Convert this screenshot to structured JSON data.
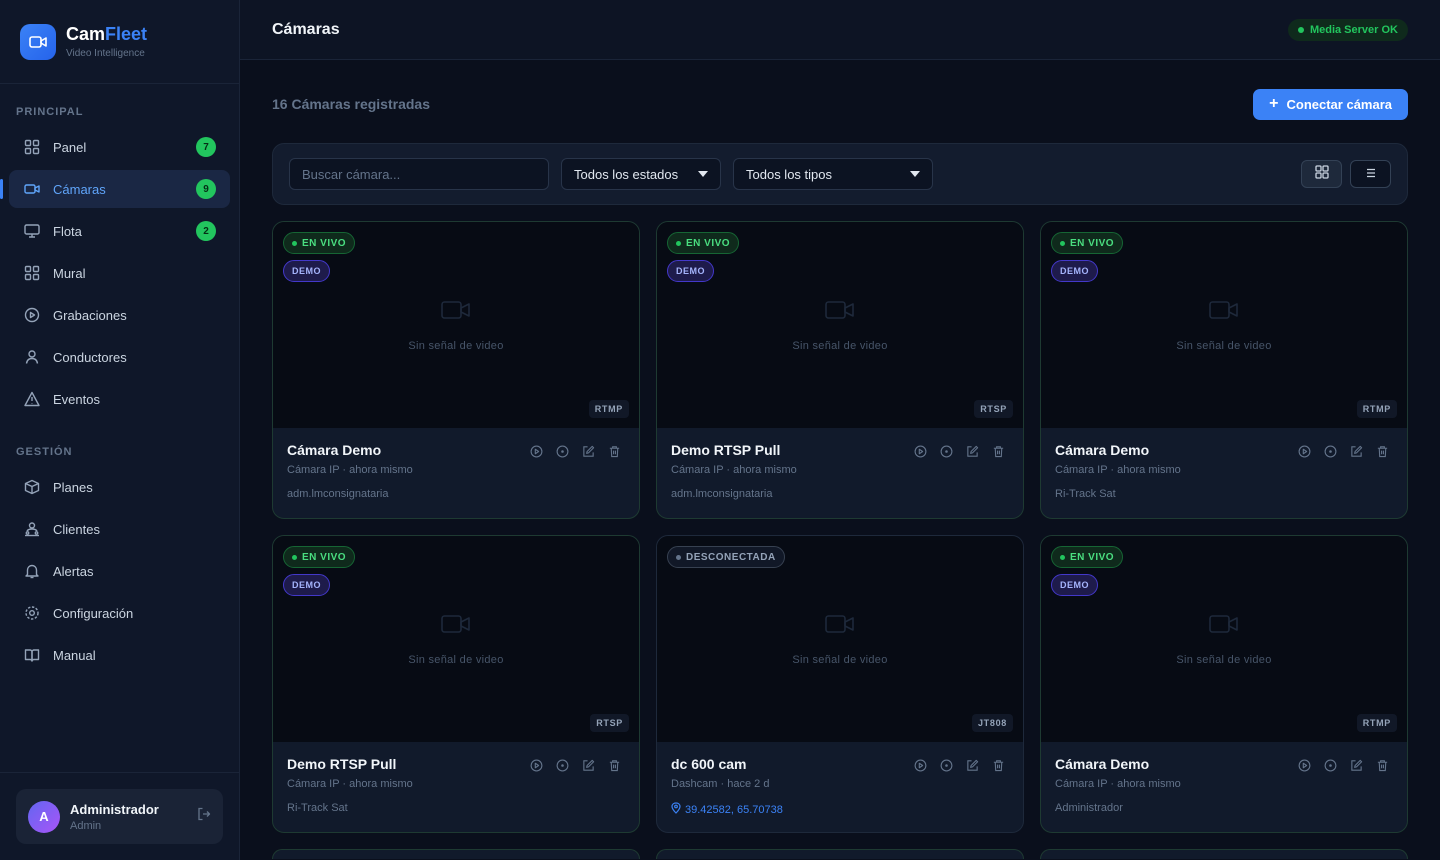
{
  "brand": {
    "name_a": "Cam",
    "name_b": "Fleet",
    "subtitle": "Video Intelligence"
  },
  "sidebar": {
    "sections": [
      {
        "title": "PRINCIPAL"
      },
      {
        "title": "GESTIÓN"
      }
    ],
    "items": [
      {
        "label": "Panel",
        "badge": "7"
      },
      {
        "label": "Cámaras",
        "badge": "9"
      },
      {
        "label": "Flota",
        "badge": "2"
      },
      {
        "label": "Mural"
      },
      {
        "label": "Grabaciones"
      },
      {
        "label": "Conductores"
      },
      {
        "label": "Eventos"
      },
      {
        "label": "Planes"
      },
      {
        "label": "Clientes"
      },
      {
        "label": "Alertas"
      },
      {
        "label": "Configuración"
      },
      {
        "label": "Manual"
      }
    ],
    "user": {
      "initial": "A",
      "name": "Administrador",
      "role": "Admin"
    }
  },
  "topbar": {
    "title": "Cámaras",
    "status": "Media Server OK"
  },
  "main": {
    "count_label": "16 Cámaras registradas",
    "connect_label": "Conectar cámara",
    "search_placeholder": "Buscar cámara...",
    "filter_status": "Todos los estados",
    "filter_type": "Todos los tipos"
  },
  "labels": {
    "live": "EN VIVO",
    "offline": "DESCONECTADA",
    "demo": "DEMO",
    "no_signal": "Sin señal de video"
  },
  "cameras": [
    {
      "name": "Cámara Demo",
      "meta": "Cámara IP · ahora mismo",
      "owner": "adm.lmconsignataria",
      "protocol": "RTMP",
      "status": "live",
      "demo": true
    },
    {
      "name": "Demo RTSP Pull",
      "meta": "Cámara IP · ahora mismo",
      "owner": "adm.lmconsignataria",
      "protocol": "RTSP",
      "status": "live",
      "demo": true
    },
    {
      "name": "Cámara Demo",
      "meta": "Cámara IP · ahora mismo",
      "owner": "Ri-Track Sat",
      "protocol": "RTMP",
      "status": "live",
      "demo": true
    },
    {
      "name": "Demo RTSP Pull",
      "meta": "Cámara IP · ahora mismo",
      "owner": "Ri-Track Sat",
      "protocol": "RTSP",
      "status": "live",
      "demo": true
    },
    {
      "name": "dc 600 cam",
      "meta": "Dashcam · hace 2 d",
      "coords": "39.42582, 65.70738",
      "protocol": "JT808",
      "status": "offline",
      "demo": false
    },
    {
      "name": "Cámara Demo",
      "meta": "Cámara IP · ahora mismo",
      "owner": "Administrador",
      "protocol": "RTMP",
      "status": "live",
      "demo": true
    }
  ],
  "colors": {
    "accent": "#3b82f6",
    "live": "#22c55e",
    "bg": "#0a0f1c"
  }
}
